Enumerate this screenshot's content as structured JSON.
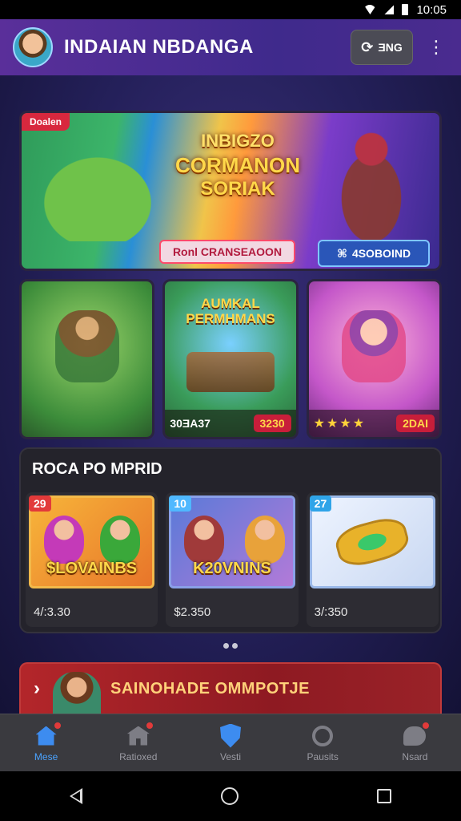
{
  "status_bar": {
    "time": "10:05",
    "icons": [
      "wifi-icon",
      "signal-icon",
      "battery-icon"
    ]
  },
  "app_bar": {
    "title": "INDAIAN NBDANGA",
    "sync_label": "ƎNG",
    "sync_icon": "sync-icon",
    "more_icon": "more-vert-icon"
  },
  "hero": {
    "tag": "Doalen",
    "title_line1": "INBIGZO",
    "title_line2": "CORMANON",
    "title_line3": "SORIAK",
    "subtitle": "Ronl CRANSEAOON",
    "cta": "4SOBOIND",
    "cta_icon": "gamepad-icon"
  },
  "features": [
    {
      "title": "",
      "label": "",
      "badge": "",
      "stars": ""
    },
    {
      "title_line1": "AUMKAL",
      "title_line2": "PERMHMANS",
      "label": "30ƎA37",
      "badge": "3230"
    },
    {
      "title": "",
      "stars": "★★★★",
      "badge": "2DAI"
    }
  ],
  "section": {
    "title": "ROCA PO MPRID",
    "offers": [
      {
        "num": "29",
        "caption": "$LOVAINBS",
        "price": "4/:3.30"
      },
      {
        "num": "10",
        "caption": "K20VNINS",
        "price": "$2.350"
      },
      {
        "num": "27",
        "caption": "",
        "price": "3/:350"
      }
    ]
  },
  "pager": {
    "count": 2
  },
  "promo": {
    "text": "SAINOHADE OMMPOTJE",
    "chevron": "›"
  },
  "bottom_nav": [
    {
      "label": "Mese",
      "icon": "home-icon",
      "active": true,
      "dot": true
    },
    {
      "label": "Ratioxed",
      "icon": "store-icon",
      "active": false,
      "dot": true
    },
    {
      "label": "Vesti",
      "icon": "shield-icon",
      "active": false,
      "dot": false
    },
    {
      "label": "Pausits",
      "icon": "clock-icon",
      "active": false,
      "dot": false
    },
    {
      "label": "Nsard",
      "icon": "chat-icon",
      "active": false,
      "dot": true
    }
  ],
  "colors": {
    "accent": "#3d8cf0",
    "gold": "#ffd84a",
    "danger": "#e23a3a"
  }
}
